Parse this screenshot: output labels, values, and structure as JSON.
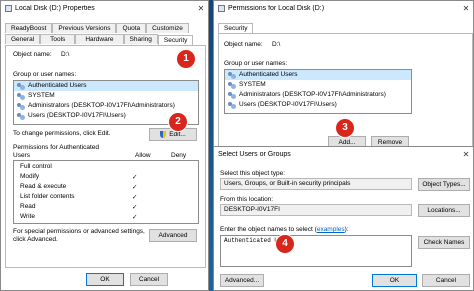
{
  "props": {
    "title": "Local Disk (D:) Properties",
    "tabs_top": [
      "ReadyBoost",
      "Previous Versions",
      "Quota",
      "Customize"
    ],
    "tabs_bottom": [
      "General",
      "Tools",
      "Hardware",
      "Sharing",
      "Security"
    ],
    "object_name_label": "Object name:",
    "object_name_value": "D:\\",
    "group_label": "Group or user names:",
    "users": [
      "Authenticated Users",
      "SYSTEM",
      "Administrators (DESKTOP-I0V17FI\\Administrators)",
      "Users (DESKTOP-I0V17FI\\Users)"
    ],
    "change_text": "To change permissions, click Edit.",
    "edit_button": "Edit...",
    "perm_header_1": "Permissions for Authenticated",
    "perm_header_2": "Users",
    "allow_label": "Allow",
    "deny_label": "Deny",
    "permissions": [
      {
        "name": "Full control",
        "allow": ""
      },
      {
        "name": "Modify",
        "allow": "✓"
      },
      {
        "name": "Read & execute",
        "allow": "✓"
      },
      {
        "name": "List folder contents",
        "allow": "✓"
      },
      {
        "name": "Read",
        "allow": "✓"
      },
      {
        "name": "Write",
        "allow": "✓"
      }
    ],
    "special_text_1": "For special permissions or advanced settings,",
    "special_text_2": "click Advanced.",
    "advanced_button": "Advanced",
    "ok_button": "OK",
    "cancel_button": "Cancel"
  },
  "perm_dialog": {
    "title": "Permissions for Local Disk (D:)",
    "tab": "Security",
    "object_name_label": "Object name:",
    "object_name_value": "D:\\",
    "group_label": "Group or user names:",
    "users": [
      "Authenticated Users",
      "SYSTEM",
      "Administrators (DESKTOP-I0V17FI\\Administrators)",
      "Users (DESKTOP-I0V17FI\\Users)"
    ],
    "add_button": "Add...",
    "remove_button": "Remove"
  },
  "select_dialog": {
    "title": "Select Users or Groups",
    "object_type_label": "Select this object type:",
    "object_type_value": "Users, Groups, or Built-in security principals",
    "object_types_button": "Object Types...",
    "location_label": "From this location:",
    "location_value": "DESKTOP-I0V17FI",
    "locations_button": "Locations...",
    "enter_label_prefix": "Enter the object names to select (",
    "enter_label_link": "examples",
    "enter_label_suffix": "):",
    "enter_value": "Authenticated Users",
    "check_names_button": "Check Names",
    "advanced_button": "Advanced...",
    "ok_button": "OK",
    "cancel_button": "Cancel"
  },
  "steps": [
    "1",
    "2",
    "3",
    "4"
  ],
  "colors": {
    "badge": "#d9261c",
    "selection": "#cce8ff",
    "desktop": "#1c5c97"
  }
}
